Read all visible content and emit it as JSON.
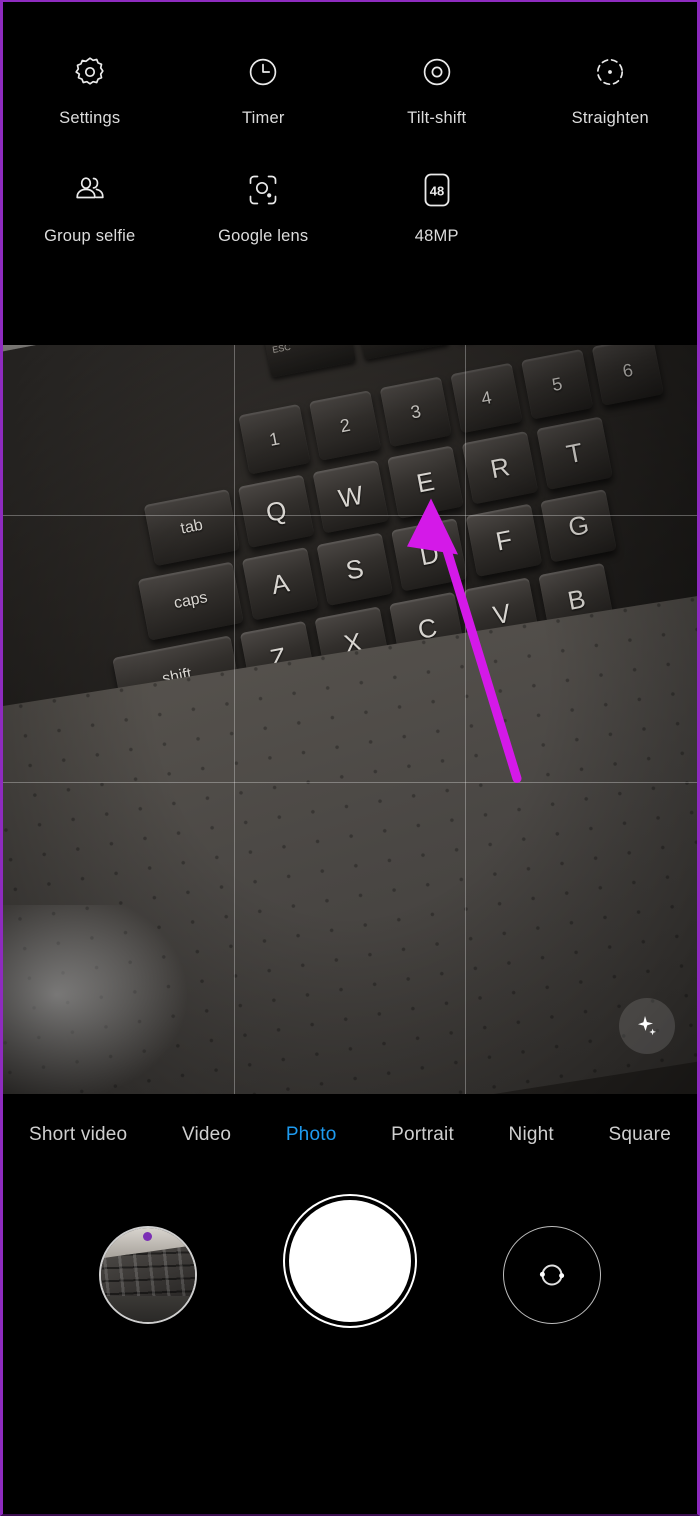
{
  "app": {
    "name": "Camera",
    "accent_blue": "#1e9bf0",
    "annotation_color": "#d419e8",
    "border_color": "#8e2bbf",
    "panel_background": "#000000"
  },
  "top_panel": {
    "rows": [
      {
        "items": [
          {
            "label": "Settings",
            "icon": "gear-icon"
          },
          {
            "label": "Timer",
            "icon": "clock-icon"
          },
          {
            "label": "Tilt-shift",
            "icon": "concentric-circle-icon"
          },
          {
            "label": "Straighten",
            "icon": "dashed-circle-dot-icon"
          }
        ]
      },
      {
        "items": [
          {
            "label": "Group selfie",
            "icon": "two-people-icon"
          },
          {
            "label": "Google lens",
            "icon": "lens-frame-icon"
          },
          {
            "label": "48MP",
            "icon": "48-badge-icon"
          }
        ]
      }
    ]
  },
  "viewfinder": {
    "grid": "on",
    "ai_button_icon": "sparkle-icon",
    "annotation": {
      "type": "arrow",
      "points_to": "48MP",
      "color": "#d419e8"
    }
  },
  "bottom_bar": {
    "modes": [
      {
        "label": "Short video",
        "active": false
      },
      {
        "label": "Video",
        "active": false
      },
      {
        "label": "Photo",
        "active": true
      },
      {
        "label": "Portrait",
        "active": false
      },
      {
        "label": "Night",
        "active": false
      },
      {
        "label": "Square",
        "active": false
      }
    ],
    "thumbnail_label": "Last photo thumbnail",
    "shutter_label": "Shutter",
    "flip_label": "Switch camera",
    "flip_icon": "camera-flip-icon"
  }
}
